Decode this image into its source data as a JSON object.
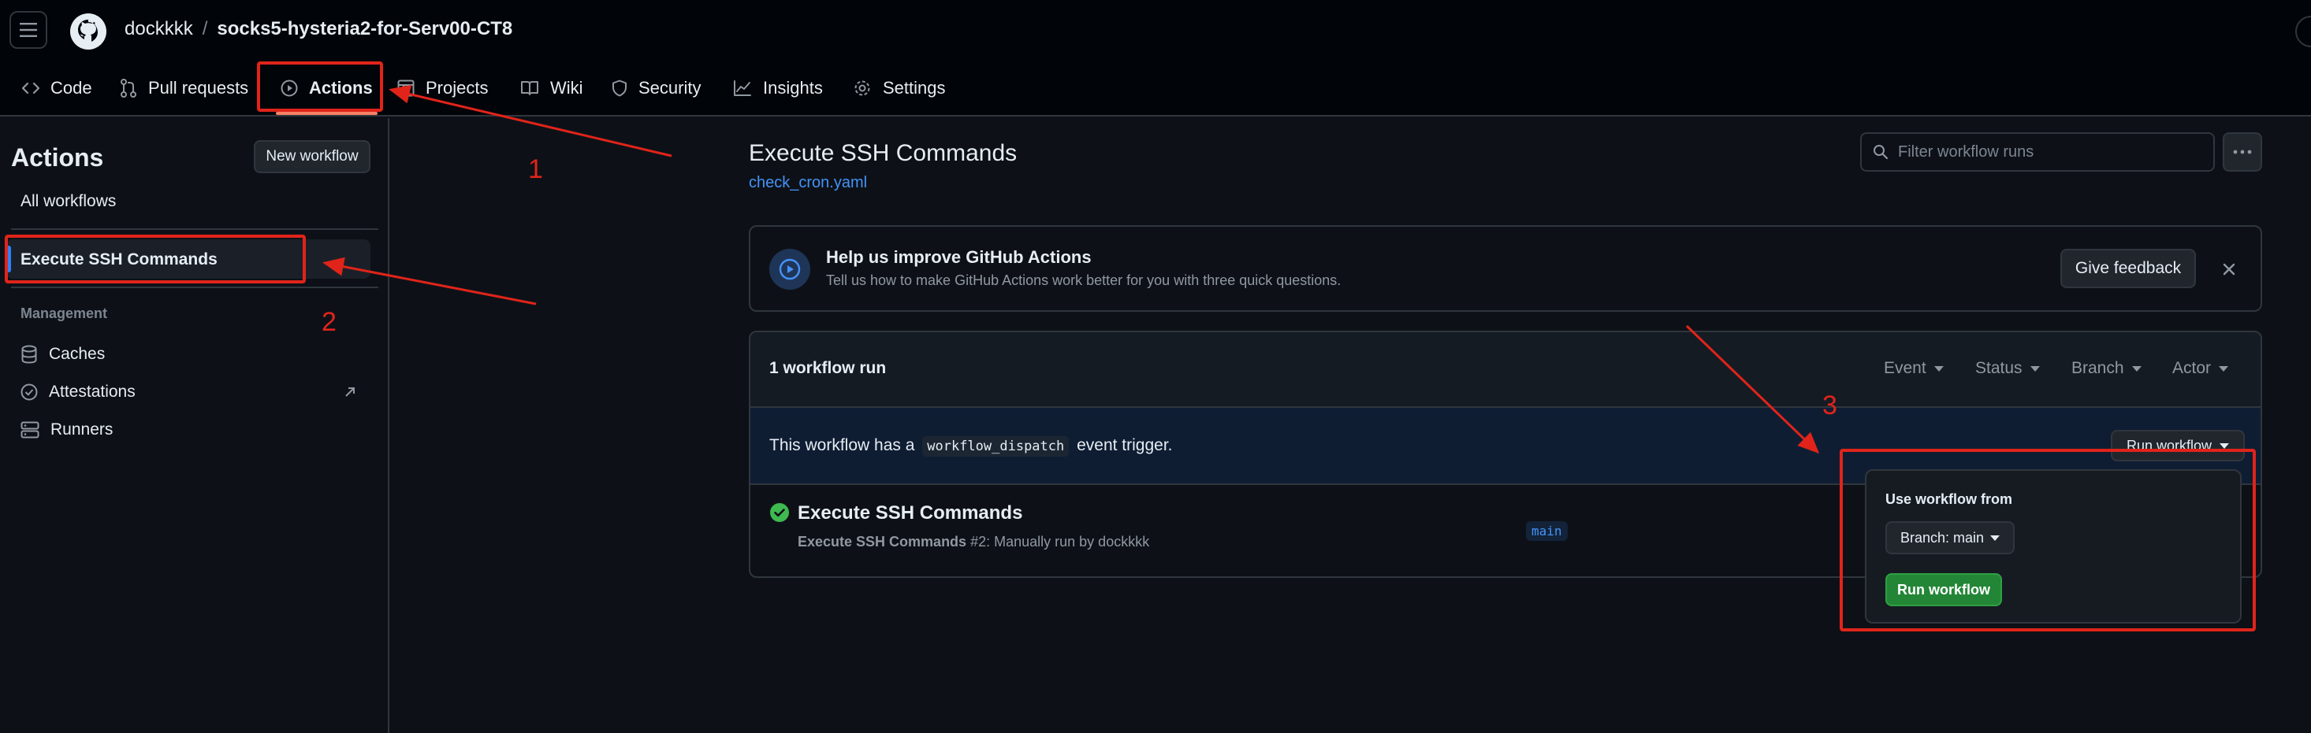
{
  "header": {
    "owner": "dockkkk",
    "separator": "/",
    "repo": "socks5-hysteria2-for-Serv00-CT8"
  },
  "repo_nav": {
    "tabs": [
      {
        "label": "Code",
        "icon": "code-icon"
      },
      {
        "label": "Pull requests",
        "icon": "git-pull-request-icon"
      },
      {
        "label": "Actions",
        "icon": "play-icon",
        "active": true
      },
      {
        "label": "Projects",
        "icon": "table-icon"
      },
      {
        "label": "Wiki",
        "icon": "book-icon"
      },
      {
        "label": "Security",
        "icon": "shield-icon"
      },
      {
        "label": "Insights",
        "icon": "graph-icon"
      },
      {
        "label": "Settings",
        "icon": "gear-icon"
      }
    ]
  },
  "sidebar": {
    "title": "Actions",
    "new_workflow": "New workflow",
    "all_workflows": "All workflows",
    "selected_workflow": "Execute SSH Commands",
    "management_heading": "Management",
    "management_items": [
      {
        "label": "Caches",
        "icon": "database-icon"
      },
      {
        "label": "Attestations",
        "icon": "verified-icon"
      },
      {
        "label": "Runners",
        "icon": "server-icon"
      }
    ]
  },
  "main": {
    "workflow_title": "Execute SSH Commands",
    "workflow_file": "check_cron.yaml",
    "filter_placeholder": "Filter workflow runs",
    "banner": {
      "title": "Help us improve GitHub Actions",
      "subtitle": "Tell us how to make GitHub Actions work better for you with three quick questions.",
      "feedback_button": "Give feedback"
    },
    "runs": {
      "count_label": "1 workflow run",
      "filters": [
        "Event",
        "Status",
        "Branch",
        "Actor"
      ],
      "trigger_prefix": "This workflow has a",
      "trigger_code": "workflow_dispatch",
      "trigger_suffix": "event trigger.",
      "run_workflow_button": "Run workflow",
      "items": [
        {
          "title": "Execute SSH Commands",
          "subtitle_name": "Execute SSH Commands",
          "subtitle_rest": "#2: Manually run by dockkkk",
          "branch": "main",
          "status": "success"
        }
      ]
    },
    "popover": {
      "title": "Use workflow from",
      "branch_select": "Branch: main",
      "submit": "Run workflow"
    }
  },
  "annotations": {
    "labels": [
      "1",
      "2",
      "3"
    ],
    "color": "#e0241a"
  },
  "colors": {
    "background": "#0d1117",
    "header": "#010409",
    "accent": "#f78166",
    "link": "#4493f8",
    "success": "#3fb950",
    "primary_button": "#238636"
  }
}
